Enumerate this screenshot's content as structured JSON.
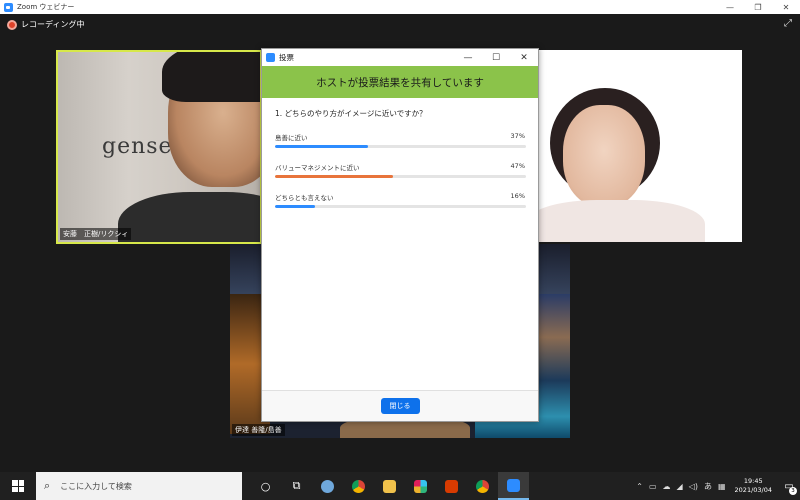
{
  "window": {
    "title": "Zoom ウェビナー",
    "minimize": "—",
    "restore": "❐",
    "close": "✕"
  },
  "recording": {
    "label": "レコーディング中"
  },
  "participants": [
    {
      "name": "安藤　正樹/リクシィ",
      "background_text": "gensen"
    },
    {
      "name": "伊達 善隆/島善"
    }
  ],
  "poll": {
    "title": "投票",
    "banner": "ホストが投票結果を共有しています",
    "question": "1. どちらのやり方がイメージに近いですか？",
    "options": [
      {
        "label": "島善に近い",
        "percent_label": "37%",
        "value": 0.37,
        "color": "#2d8cff"
      },
      {
        "label": "バリューマネジメントに近い",
        "percent_label": "47%",
        "value": 0.47,
        "color": "#e8743b"
      },
      {
        "label": "どちらとも言えない",
        "percent_label": "16%",
        "value": 0.16,
        "color": "#2d8cff"
      }
    ],
    "close_button": "閉じる",
    "btn_min": "—",
    "btn_max": "☐",
    "btn_close": "✕"
  },
  "taskbar": {
    "search_placeholder": "ここに入力して検索",
    "time": "19:45",
    "date": "2021/03/04",
    "ime": "あ",
    "notification_count": "3"
  }
}
